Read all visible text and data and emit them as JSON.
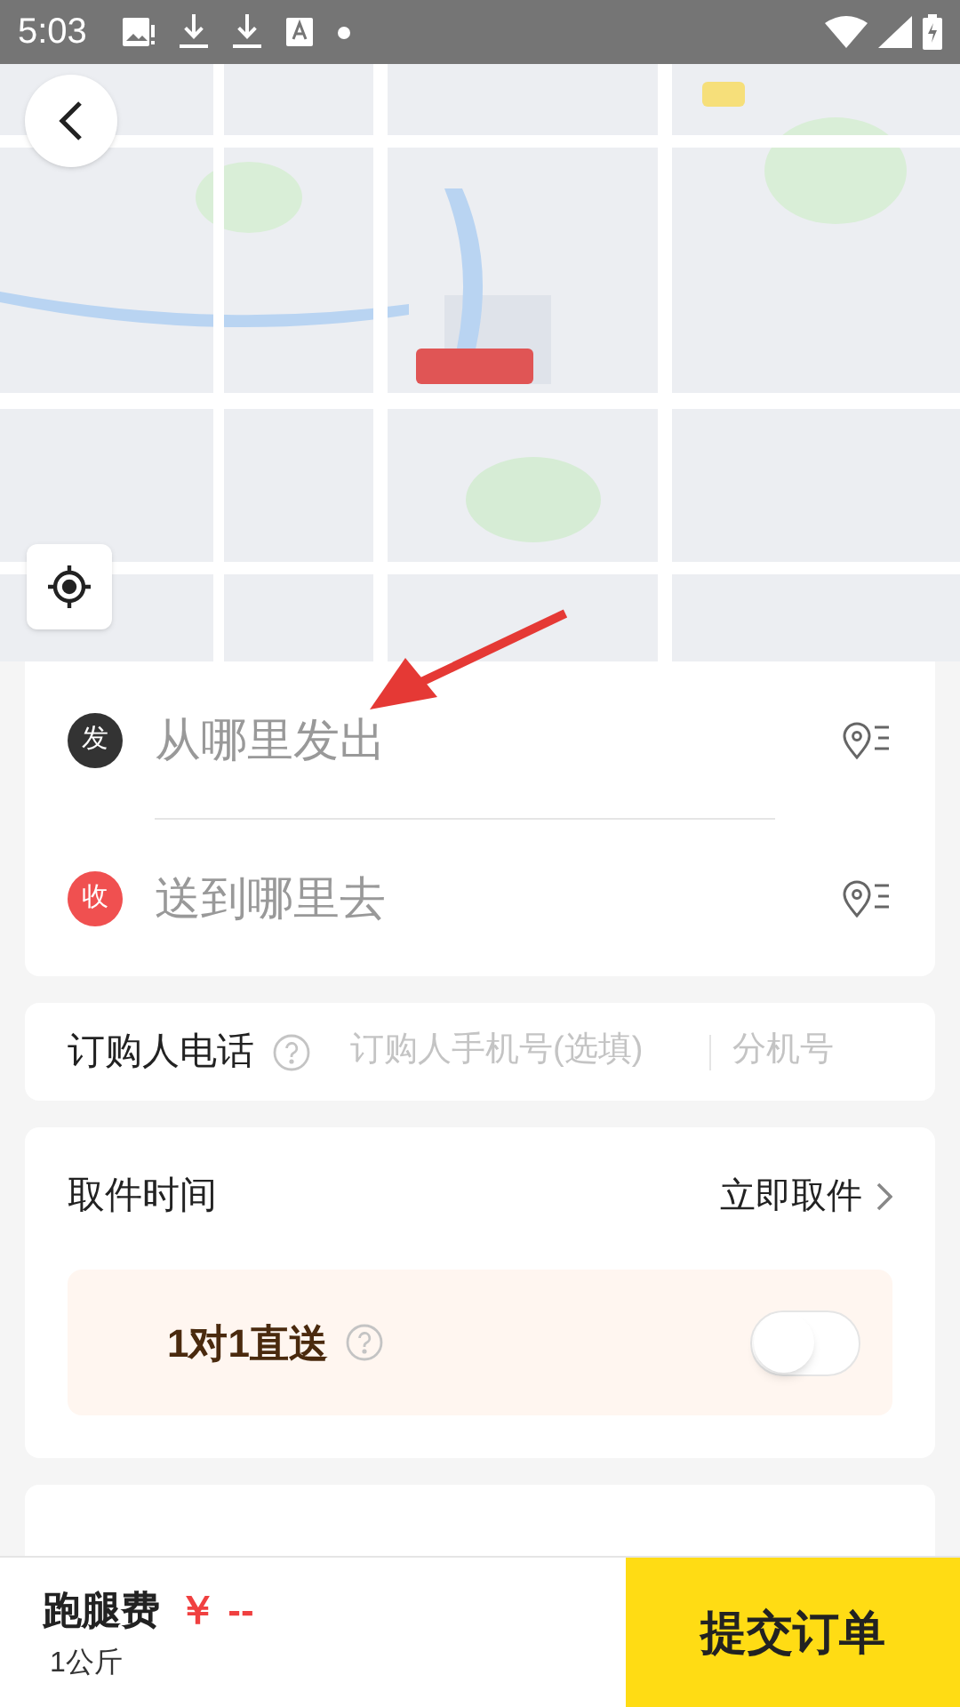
{
  "status_bar": {
    "time": "5:03"
  },
  "address_card": {
    "rows": [
      {
        "kind": "sender",
        "badge": "发",
        "placeholder": "从哪里发出"
      },
      {
        "kind": "receiver",
        "badge": "收",
        "placeholder": "送到哪里去"
      }
    ]
  },
  "phone": {
    "label": "订购人电话",
    "placeholder": "订购人手机号(选填)",
    "extension_placeholder": "分机号"
  },
  "pickup": {
    "label": "取件时间",
    "value": "立即取件",
    "direct": {
      "label": "1对1直送",
      "on": false
    }
  },
  "footer": {
    "fee_label": "跑腿费",
    "currency": "￥",
    "price": "--",
    "weight": "1公斤",
    "submit": "提交订单"
  }
}
